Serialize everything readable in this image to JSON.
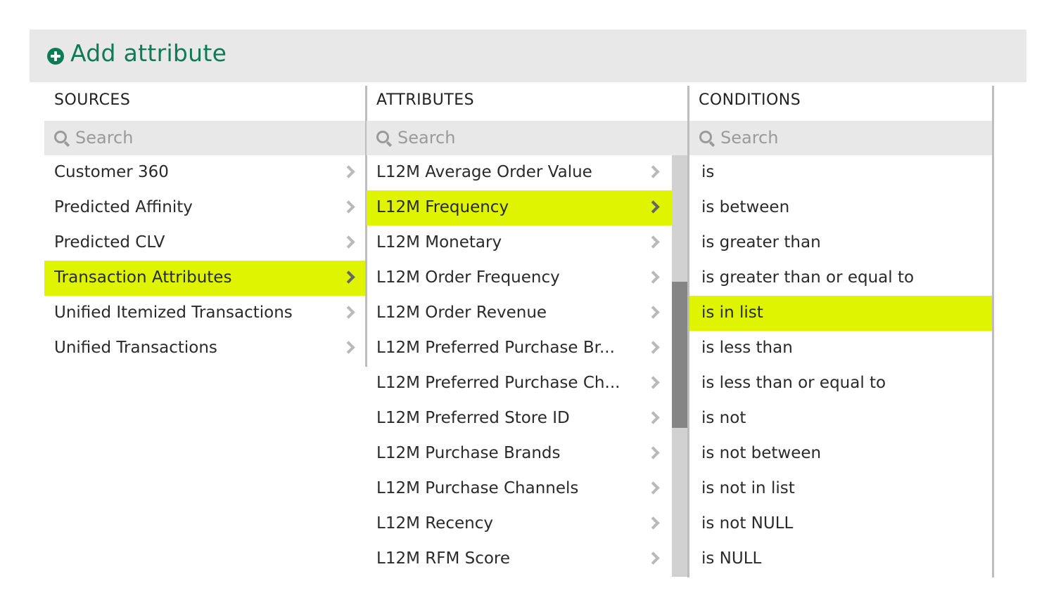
{
  "header": {
    "title": "Add attribute"
  },
  "sources": {
    "title": "SOURCES",
    "search_placeholder": "Search",
    "items": [
      {
        "label": "Customer 360"
      },
      {
        "label": "Predicted Affinity"
      },
      {
        "label": "Predicted CLV"
      },
      {
        "label": "Transaction Attributes",
        "selected": true
      },
      {
        "label": "Unified Itemized Transactions"
      },
      {
        "label": "Unified Transactions"
      }
    ]
  },
  "attributes": {
    "title": "ATTRIBUTES",
    "search_placeholder": "Search",
    "items": [
      {
        "label": "L12M Average Order Value"
      },
      {
        "label": "L12M Frequency",
        "selected": true
      },
      {
        "label": "L12M Monetary"
      },
      {
        "label": "L12M Order Frequency"
      },
      {
        "label": "L12M Order Revenue"
      },
      {
        "label": "L12M Preferred Purchase Br..."
      },
      {
        "label": "L12M Preferred Purchase Ch..."
      },
      {
        "label": "L12M Preferred Store ID"
      },
      {
        "label": "L12M Purchase Brands"
      },
      {
        "label": "L12M Purchase Channels"
      },
      {
        "label": "L12M Recency"
      },
      {
        "label": "L12M RFM Score"
      }
    ]
  },
  "conditions": {
    "title": "CONDITIONS",
    "search_placeholder": "Search",
    "items": [
      {
        "label": "is"
      },
      {
        "label": "is between"
      },
      {
        "label": "is greater than"
      },
      {
        "label": "is greater than or equal to"
      },
      {
        "label": "is in list",
        "selected": true
      },
      {
        "label": "is less than"
      },
      {
        "label": "is less than or equal to"
      },
      {
        "label": "is not"
      },
      {
        "label": "is not between"
      },
      {
        "label": "is not in list"
      },
      {
        "label": "is not NULL"
      },
      {
        "label": "is NULL"
      }
    ]
  },
  "colors": {
    "brand": "#0d7b55",
    "selection": "#dff400",
    "panel": "#e8e8e8"
  },
  "icons": {
    "header": "plus-circle-icon",
    "search": "search-icon",
    "row": "chevron-right-icon"
  }
}
